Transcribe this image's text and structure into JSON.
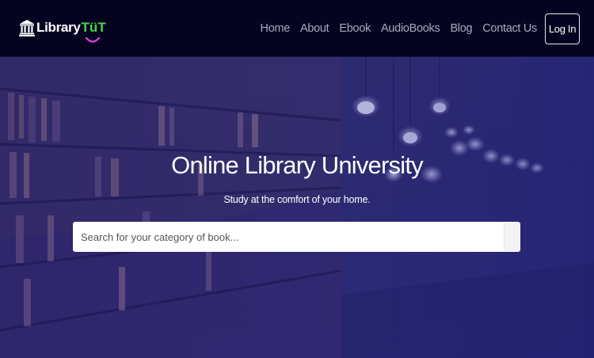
{
  "brand": {
    "name": "Library",
    "accent": "TüT",
    "icon": "library-building-icon"
  },
  "nav": {
    "items": [
      {
        "label": "Home"
      },
      {
        "label": "About"
      },
      {
        "label": "Ebook"
      },
      {
        "label": "AudioBooks"
      },
      {
        "label": "Blog"
      },
      {
        "label": "Contact Us"
      }
    ],
    "login_label": "Log In"
  },
  "hero": {
    "title": "Online Library University",
    "subtitle": "Study at the comfort of your home.",
    "search": {
      "placeholder": "Search for your category of book...",
      "value": ""
    }
  },
  "colors": {
    "navbar": "#050420",
    "hero_tint": "#2c2a6c",
    "brand_accent": "#46d84a",
    "smile": "#e040e0"
  }
}
